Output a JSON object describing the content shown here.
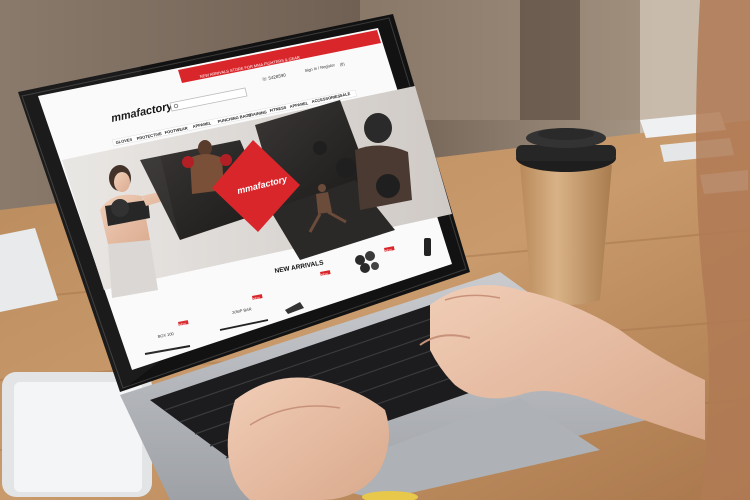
{
  "scene": {
    "description_free": true,
    "colors": {
      "brand_red": "#d9262b",
      "wood": "#c99a6c",
      "laptop_silver": "#b9bcc0",
      "screen_black": "#141414",
      "cup_kraft": "#d3a779",
      "cup_lid": "#222222"
    }
  },
  "website": {
    "topbar_text": "NEW ARRIVALS STORE FOR MMA FIGHTERS & GEAR",
    "phone": "☏ 5428590",
    "sign_in": "Sign In / Register",
    "cart": "(0)",
    "logo": "mmafactory",
    "nav": [
      "GLOVES",
      "PROTECTIVE",
      "FOOTWEAR",
      "APPAREL",
      "PUNCHING BAGS",
      "TRAINING",
      "FITNESS",
      "APPAREL",
      "ACCESSORIES",
      "SALE"
    ],
    "section_title": "NEW ARRIVALS",
    "badges": [
      "NEW",
      "NEW",
      "NEW",
      "NEW",
      "NEW",
      "NEW"
    ],
    "product_labels": [
      "BOX 100",
      "JUMP BAR"
    ]
  }
}
